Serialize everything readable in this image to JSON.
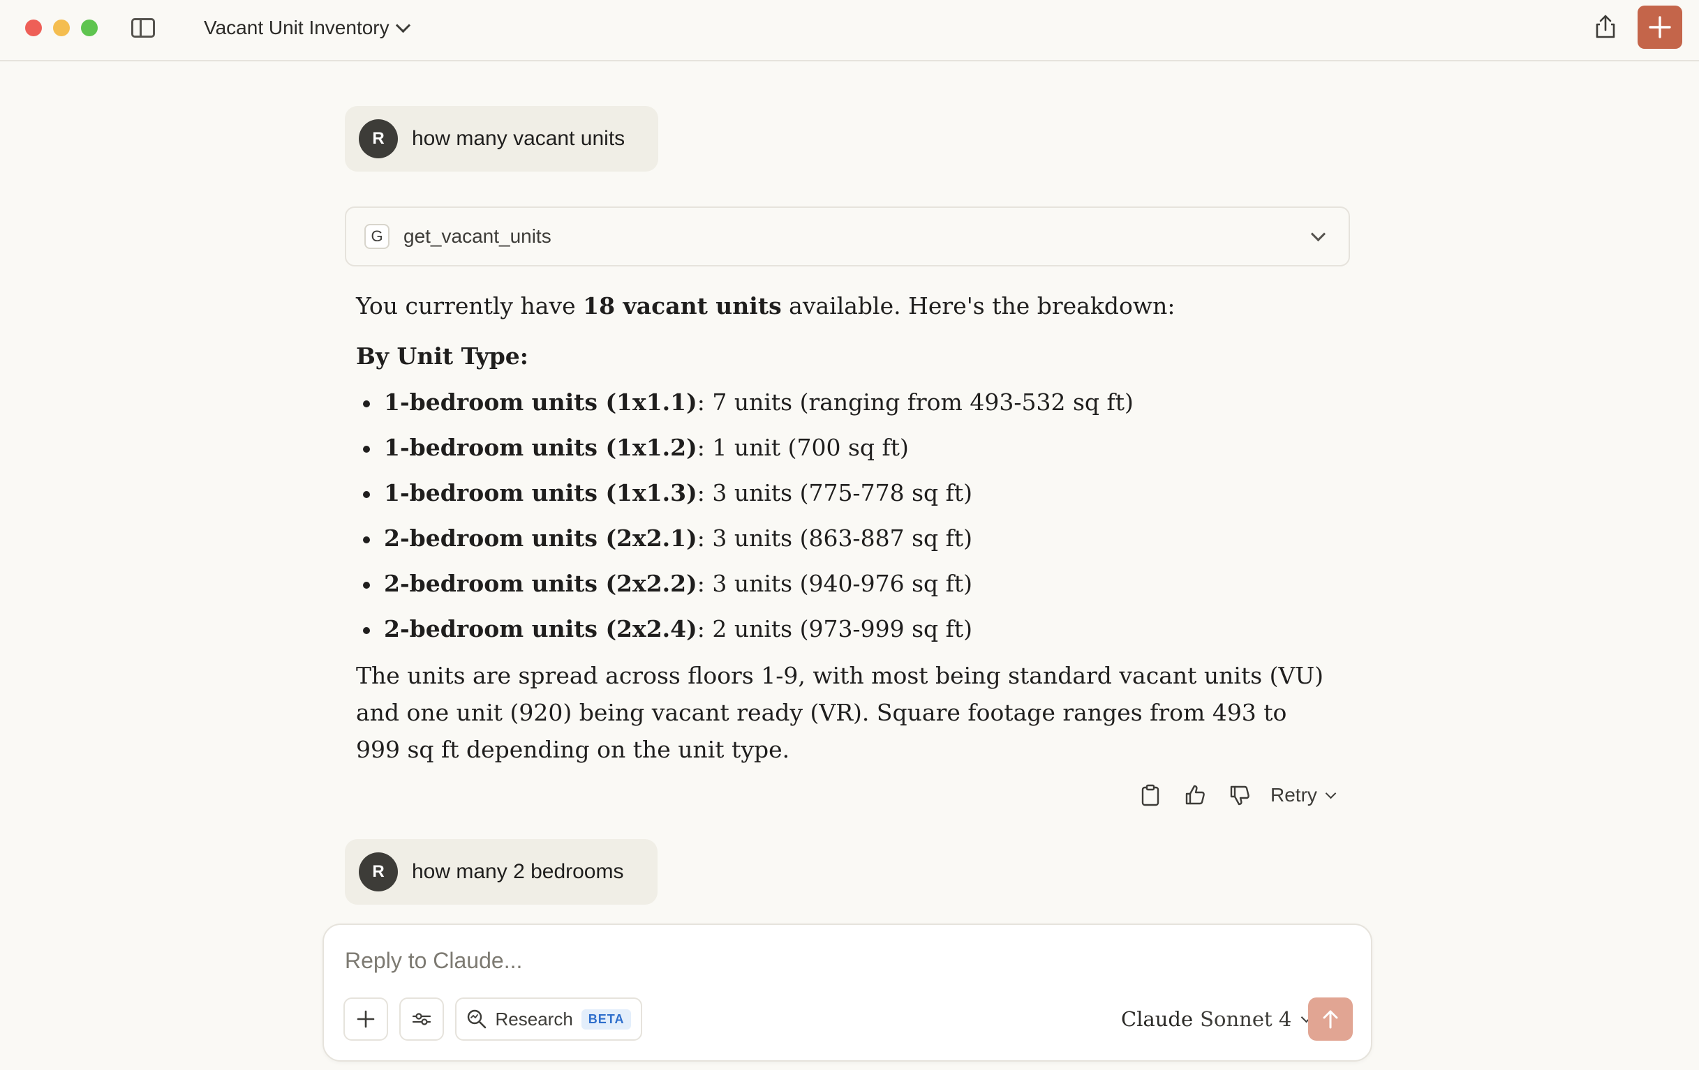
{
  "window": {
    "title": "Vacant Unit Inventory"
  },
  "messages": {
    "user1": {
      "avatar_initial": "R",
      "text": "how many vacant units"
    },
    "tool_call": {
      "icon_letter": "G",
      "name": "get_vacant_units"
    },
    "assistant1": {
      "intro_prefix": "You currently have ",
      "intro_bold": "18 vacant units",
      "intro_suffix": " available. Here's the breakdown:",
      "heading": "By Unit Type:",
      "items": [
        {
          "bold": "1-bedroom units (1x1.1)",
          "rest": ": 7 units (ranging from 493-532 sq ft)"
        },
        {
          "bold": "1-bedroom units (1x1.2)",
          "rest": ": 1 unit (700 sq ft)"
        },
        {
          "bold": "1-bedroom units (1x1.3)",
          "rest": ": 3 units (775-778 sq ft)"
        },
        {
          "bold": "2-bedroom units (2x2.1)",
          "rest": ": 3 units (863-887 sq ft)"
        },
        {
          "bold": "2-bedroom units (2x2.2)",
          "rest": ": 3 units (940-976 sq ft)"
        },
        {
          "bold": "2-bedroom units (2x2.4)",
          "rest": ": 2 units (973-999 sq ft)"
        }
      ],
      "summary": "The units are spread across floors 1-9, with most being standard vacant units (VU) and one unit (920) being vacant ready (VR). Square footage ranges from 493 to 999 sq ft depending on the unit type."
    },
    "actions": {
      "retry_label": "Retry"
    },
    "user2": {
      "avatar_initial": "R",
      "text": "how many 2 bedrooms"
    }
  },
  "composer": {
    "placeholder": "Reply to Claude...",
    "research_label": "Research",
    "beta_label": "BETA",
    "model_brand": "Claude",
    "model_name": "Sonnet 4"
  },
  "colors": {
    "accent": "#c4654a",
    "send_disabled": "#e1a593",
    "background": "#faf9f5",
    "user_bubble": "#f0eee6"
  },
  "icons": {
    "sidebar_toggle": "sidebar-icon",
    "share": "share-icon",
    "new_chat": "plus-icon",
    "copy": "clipboard-icon",
    "thumbs_up": "thumbs-up-icon",
    "thumbs_down": "thumbs-down-icon",
    "research": "search-icon",
    "tools": "sliders-icon",
    "send": "arrow-up-icon"
  }
}
